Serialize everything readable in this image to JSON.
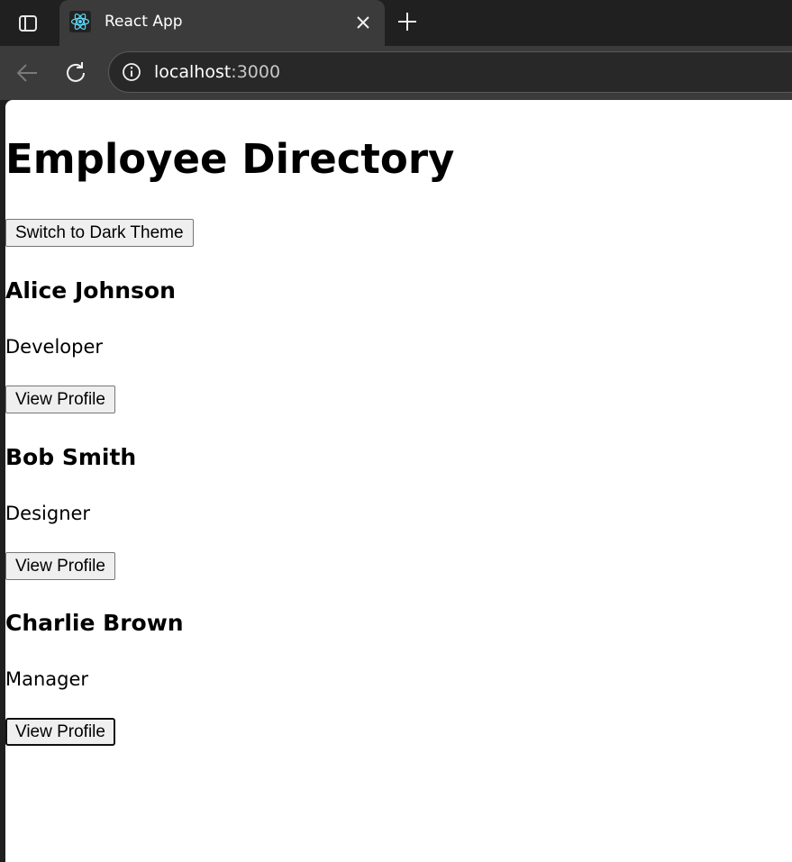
{
  "browser": {
    "tab_title": "React App",
    "url_host": "localhost",
    "url_port": ":3000"
  },
  "page": {
    "heading": "Employee Directory",
    "theme_button_label": "Switch to Dark Theme",
    "employees": [
      {
        "name": "Alice Johnson",
        "role": "Developer",
        "button_label": "View Profile"
      },
      {
        "name": "Bob Smith",
        "role": "Designer",
        "button_label": "View Profile"
      },
      {
        "name": "Charlie Brown",
        "role": "Manager",
        "button_label": "View Profile"
      }
    ]
  },
  "icons": {
    "tab_actions": "sidebar-panel-icon",
    "favicon": "react-logo-icon",
    "close": "close-icon",
    "new_tab": "plus-icon",
    "back": "back-arrow-icon",
    "reload": "reload-icon",
    "site_info": "info-icon"
  },
  "colors": {
    "react_blue": "#61dafb",
    "browser_frame": "#202020",
    "toolbar": "#3b3b3b"
  }
}
